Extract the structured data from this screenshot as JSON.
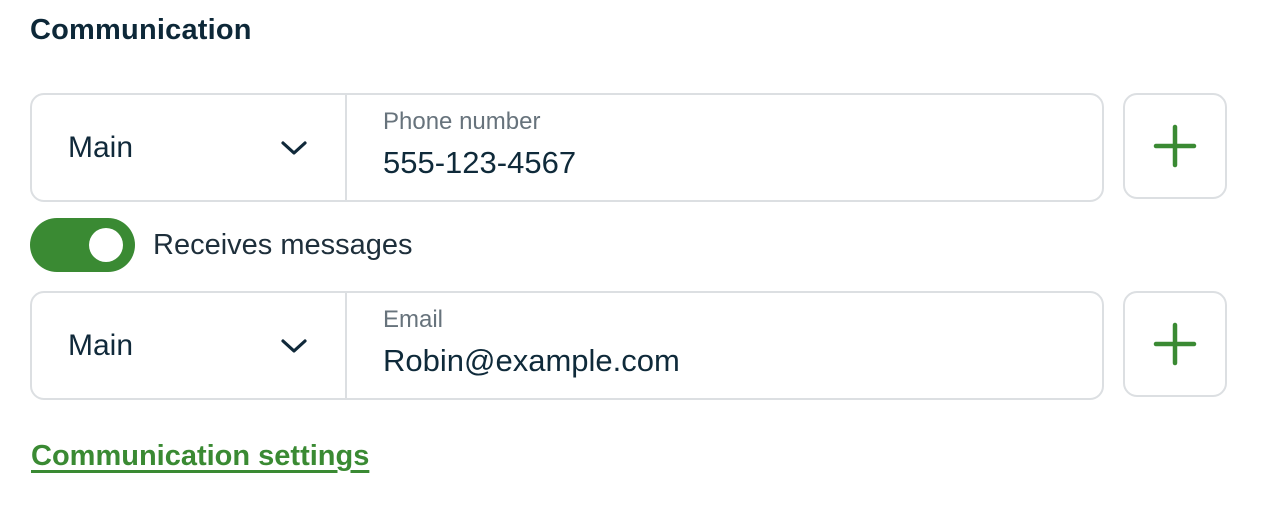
{
  "section": {
    "title": "Communication"
  },
  "phone": {
    "type_label": "Main",
    "field_label": "Phone number",
    "value": "555-123-4567",
    "add_icon": "plus-icon"
  },
  "messages_toggle": {
    "label": "Receives messages",
    "on": true
  },
  "email": {
    "type_label": "Main",
    "field_label": "Email",
    "value": "Robin@example.com",
    "add_icon": "plus-icon"
  },
  "settings_link": {
    "label": "Communication settings"
  },
  "colors": {
    "accent": "#3a8a33",
    "heading": "#0d2838",
    "border": "#dcdfe2",
    "muted_label": "#67737c"
  }
}
